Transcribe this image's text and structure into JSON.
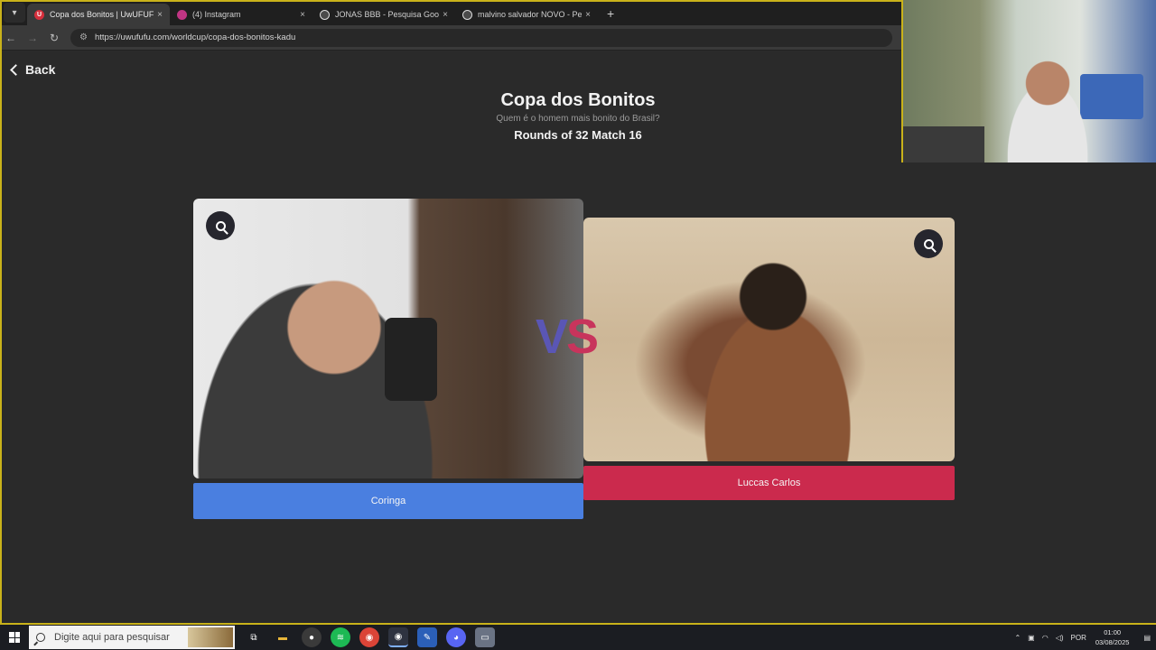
{
  "browser": {
    "tabs": [
      {
        "title": "Copa dos Bonitos | UwUFUFU",
        "favicon_color": "#d62f3c",
        "favicon_text": "U",
        "active": true
      },
      {
        "title": "(4) Instagram",
        "favicon_color": "#c13584",
        "favicon_text": "",
        "active": false
      },
      {
        "title": "JONAS BBB - Pesquisa Google",
        "favicon_color": "#4a4a4a",
        "favicon_text": "",
        "active": false
      },
      {
        "title": "malvino salvador NOVO - Pesq",
        "favicon_color": "#4a4a4a",
        "favicon_text": "",
        "active": false
      }
    ],
    "new_tab": "+",
    "close_glyph": "×",
    "url": "https://uwufufu.com/worldcup/copa-dos-bonitos-kadu"
  },
  "page": {
    "back_label": "Back",
    "title": "Copa dos Bonitos",
    "subtitle": "Quem é o homem mais bonito do Brasil?",
    "round": "Rounds of 32 Match 16",
    "vs_v": "V",
    "vs_s": "S",
    "left_choice": {
      "label": "Coringa",
      "color": "#4a7fe0"
    },
    "right_choice": {
      "label": "Luccas Carlos",
      "color": "#cb2a4d"
    }
  },
  "taskbar": {
    "search_placeholder": "Digite aqui para pesquisar",
    "apps": [
      {
        "name": "task-view-icon",
        "glyph": "⧉",
        "color": "transparent"
      },
      {
        "name": "file-explorer-icon",
        "glyph": "▬",
        "color": "#e8b53a"
      },
      {
        "name": "obs-icon",
        "glyph": "●",
        "color": "#3a3a3a"
      },
      {
        "name": "spotify-icon",
        "glyph": "≋",
        "color": "#1db954"
      },
      {
        "name": "chrome-icon",
        "glyph": "◉",
        "color": "#db4437"
      },
      {
        "name": "chrome-alt-icon",
        "glyph": "◉",
        "color": "#6a8f4a"
      },
      {
        "name": "editor-icon",
        "glyph": "✎",
        "color": "#2b5fb8"
      },
      {
        "name": "discord-icon",
        "glyph": "◕",
        "color": "#5865f2"
      },
      {
        "name": "window-icon",
        "glyph": "▭",
        "color": "#6a7384"
      }
    ],
    "tray": {
      "language": "POR",
      "time": "01:00",
      "date": "03/08/2025"
    }
  }
}
